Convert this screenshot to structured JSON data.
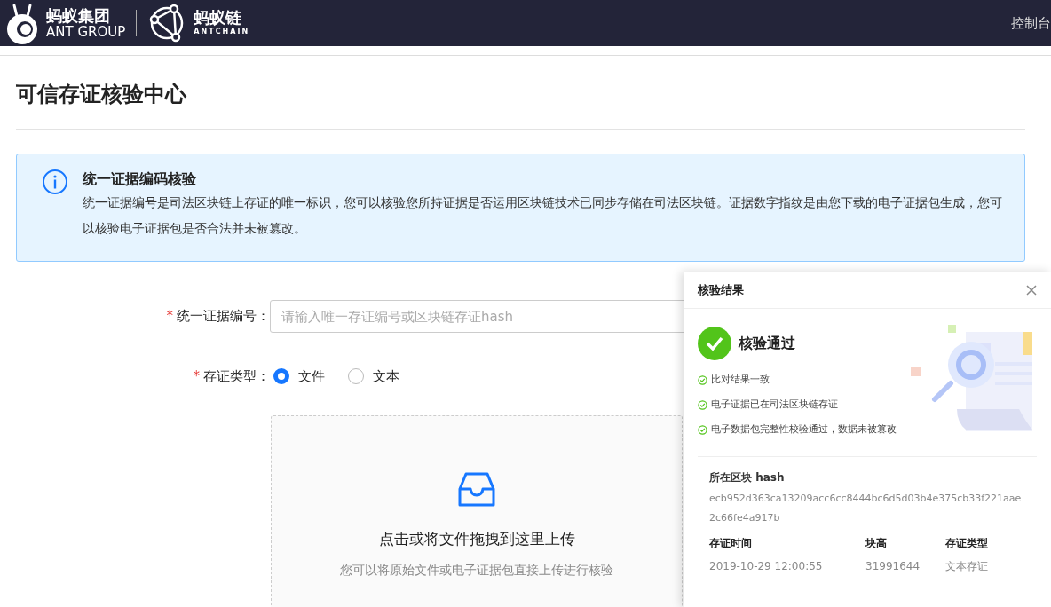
{
  "header": {
    "brand_cn": "蚂蚁集团",
    "brand_en": "ANT GROUP",
    "chain_cn": "蚂蚁链",
    "chain_en": "ANTCHAIN",
    "console_link": "控制台"
  },
  "page_title": "可信存证核验中心",
  "alert": {
    "title": "统一证据编码核验",
    "description": "统一证据编号是司法区块链上存证的唯一标识，您可以核验您所持证据是否运用区块链技术已同步存储在司法区块链。证据数字指纹是由您下载的电子证据包生成，您可以核验电子证据包是否合法并未被篡改。"
  },
  "form": {
    "fields": [
      {
        "kind": "input",
        "required_mark": "*",
        "label": "统一证据编号：",
        "placeholder": "请输入唯一存证编号或区块链存证hash"
      },
      {
        "kind": "radio",
        "required_mark": "*",
        "label": "存证类型：",
        "options": [
          {
            "label": "文件",
            "selected": true
          },
          {
            "label": "文本",
            "selected": false
          }
        ]
      }
    ]
  },
  "upload": {
    "title": "点击或将文件拖拽到这里上传",
    "hint": "您可以将原始文件或电子证据包直接上传进行核验"
  },
  "result_panel": {
    "title": "核验结果",
    "status": "核验通过",
    "checks": [
      "比对结果一致",
      "电子证据已在司法区块链存证",
      "电子数据包完整性校验通过，数据未被篡改"
    ],
    "hash_label": "所在区块 hash",
    "hash_value": "ecb952d363ca13209acc6cc8444bc6d5d03b4e375cb33f221aae2c66fe4a917b",
    "meta": [
      {
        "label": "存证时间",
        "value": "2019-10-29 12:00:55"
      },
      {
        "label": "块高",
        "value": "31991644"
      },
      {
        "label": "存证类型",
        "value": "文本存证"
      }
    ]
  }
}
